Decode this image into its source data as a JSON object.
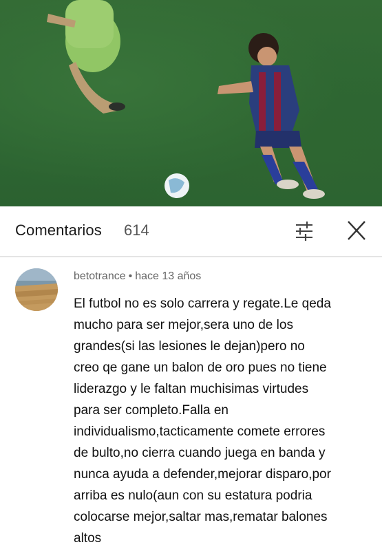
{
  "header": {
    "title": "Comentarios",
    "count": "614"
  },
  "icons": {
    "filter": "sliders-icon",
    "close": "close-icon"
  },
  "comment": {
    "author": "betotrance",
    "separator": "•",
    "time": "hace 13 años",
    "text": "El futbol no es solo carrera y regate.Le qeda\nmucho para ser mejor,sera uno de los\ngrandes(si las lesiones le dejan)pero no\ncreo qe gane un balon de oro pues no tiene\nliderazgo y le faltan muchisimas virtudes\npara ser completo.Falla en\nindividualismo,tacticamente comete errores\nde bulto,no cierra cuando juega en banda y\nnunca ayuda a defender,mejorar disparo,por\narriba es nulo(aun con su estatura podria\ncolocarse mejor,saltar mas,rematar balones\naltos"
  }
}
